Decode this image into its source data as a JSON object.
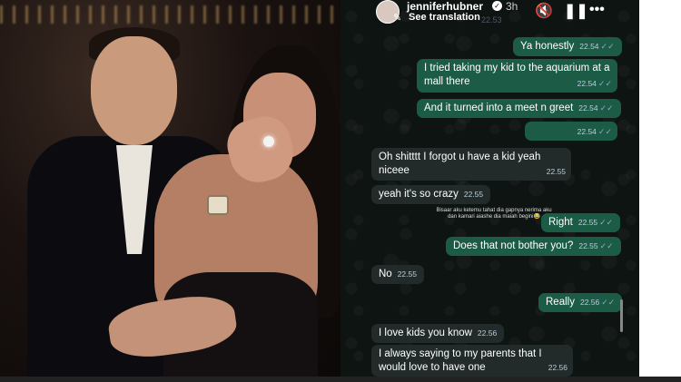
{
  "header": {
    "username": "jenniferhubner",
    "time": "3h",
    "translation_label": "See translation",
    "faint_timestamp": "22.53",
    "icons": [
      "verified-badge-icon",
      "mute-icon",
      "pause-icon",
      "more-icon"
    ]
  },
  "messages": [
    {
      "dir": "out",
      "text": "Ya honestly",
      "time": "22.54"
    },
    {
      "dir": "out",
      "text": "I tried taking my kid to the aquarium at a mall there",
      "time": "22.54"
    },
    {
      "dir": "out",
      "text": "And it turned into a meet n greet",
      "time": "22.54"
    },
    {
      "dir": "out",
      "text": "",
      "time": "22.54"
    },
    {
      "dir": "in",
      "text": "Oh shitttt I forgot u have a kid yeah niceee",
      "time": "22.55"
    },
    {
      "dir": "in",
      "text": "yeah it's so crazy",
      "time": "22.55"
    },
    {
      "dir": "out",
      "text": "Right",
      "time": "22.55"
    },
    {
      "dir": "out",
      "text": "Does that not bother you?",
      "time": "22.55"
    },
    {
      "dir": "in",
      "text": "No",
      "time": "22.55"
    },
    {
      "dir": "out",
      "text": "Really",
      "time": "22.56"
    },
    {
      "dir": "in",
      "text": "I love kids you know",
      "time": "22.56"
    },
    {
      "dir": "in",
      "text": "I always saying to my parents that I would love to have one",
      "time": "22.56"
    }
  ],
  "overlay_caption": "Bisaar aku ketemu tahat dia gapnya nerima aku dan kamari aiashe dia maiah begini😂",
  "colors": {
    "outgoing": "#1c5c46",
    "incoming": "#222a2a",
    "background": "#0e1412"
  }
}
